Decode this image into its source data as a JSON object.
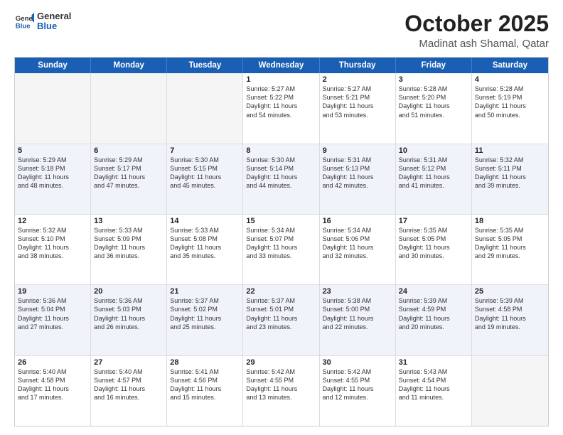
{
  "header": {
    "logo_general": "General",
    "logo_blue": "Blue",
    "month_title": "October 2025",
    "location": "Madinat ash Shamal, Qatar"
  },
  "days_of_week": [
    "Sunday",
    "Monday",
    "Tuesday",
    "Wednesday",
    "Thursday",
    "Friday",
    "Saturday"
  ],
  "weeks": [
    {
      "alt": false,
      "cells": [
        {
          "day": "",
          "empty": true,
          "lines": []
        },
        {
          "day": "",
          "empty": true,
          "lines": []
        },
        {
          "day": "",
          "empty": true,
          "lines": []
        },
        {
          "day": "1",
          "empty": false,
          "lines": [
            "Sunrise: 5:27 AM",
            "Sunset: 5:22 PM",
            "Daylight: 11 hours",
            "and 54 minutes."
          ]
        },
        {
          "day": "2",
          "empty": false,
          "lines": [
            "Sunrise: 5:27 AM",
            "Sunset: 5:21 PM",
            "Daylight: 11 hours",
            "and 53 minutes."
          ]
        },
        {
          "day": "3",
          "empty": false,
          "lines": [
            "Sunrise: 5:28 AM",
            "Sunset: 5:20 PM",
            "Daylight: 11 hours",
            "and 51 minutes."
          ]
        },
        {
          "day": "4",
          "empty": false,
          "lines": [
            "Sunrise: 5:28 AM",
            "Sunset: 5:19 PM",
            "Daylight: 11 hours",
            "and 50 minutes."
          ]
        }
      ]
    },
    {
      "alt": true,
      "cells": [
        {
          "day": "5",
          "empty": false,
          "lines": [
            "Sunrise: 5:29 AM",
            "Sunset: 5:18 PM",
            "Daylight: 11 hours",
            "and 48 minutes."
          ]
        },
        {
          "day": "6",
          "empty": false,
          "lines": [
            "Sunrise: 5:29 AM",
            "Sunset: 5:17 PM",
            "Daylight: 11 hours",
            "and 47 minutes."
          ]
        },
        {
          "day": "7",
          "empty": false,
          "lines": [
            "Sunrise: 5:30 AM",
            "Sunset: 5:15 PM",
            "Daylight: 11 hours",
            "and 45 minutes."
          ]
        },
        {
          "day": "8",
          "empty": false,
          "lines": [
            "Sunrise: 5:30 AM",
            "Sunset: 5:14 PM",
            "Daylight: 11 hours",
            "and 44 minutes."
          ]
        },
        {
          "day": "9",
          "empty": false,
          "lines": [
            "Sunrise: 5:31 AM",
            "Sunset: 5:13 PM",
            "Daylight: 11 hours",
            "and 42 minutes."
          ]
        },
        {
          "day": "10",
          "empty": false,
          "lines": [
            "Sunrise: 5:31 AM",
            "Sunset: 5:12 PM",
            "Daylight: 11 hours",
            "and 41 minutes."
          ]
        },
        {
          "day": "11",
          "empty": false,
          "lines": [
            "Sunrise: 5:32 AM",
            "Sunset: 5:11 PM",
            "Daylight: 11 hours",
            "and 39 minutes."
          ]
        }
      ]
    },
    {
      "alt": false,
      "cells": [
        {
          "day": "12",
          "empty": false,
          "lines": [
            "Sunrise: 5:32 AM",
            "Sunset: 5:10 PM",
            "Daylight: 11 hours",
            "and 38 minutes."
          ]
        },
        {
          "day": "13",
          "empty": false,
          "lines": [
            "Sunrise: 5:33 AM",
            "Sunset: 5:09 PM",
            "Daylight: 11 hours",
            "and 36 minutes."
          ]
        },
        {
          "day": "14",
          "empty": false,
          "lines": [
            "Sunrise: 5:33 AM",
            "Sunset: 5:08 PM",
            "Daylight: 11 hours",
            "and 35 minutes."
          ]
        },
        {
          "day": "15",
          "empty": false,
          "lines": [
            "Sunrise: 5:34 AM",
            "Sunset: 5:07 PM",
            "Daylight: 11 hours",
            "and 33 minutes."
          ]
        },
        {
          "day": "16",
          "empty": false,
          "lines": [
            "Sunrise: 5:34 AM",
            "Sunset: 5:06 PM",
            "Daylight: 11 hours",
            "and 32 minutes."
          ]
        },
        {
          "day": "17",
          "empty": false,
          "lines": [
            "Sunrise: 5:35 AM",
            "Sunset: 5:05 PM",
            "Daylight: 11 hours",
            "and 30 minutes."
          ]
        },
        {
          "day": "18",
          "empty": false,
          "lines": [
            "Sunrise: 5:35 AM",
            "Sunset: 5:05 PM",
            "Daylight: 11 hours",
            "and 29 minutes."
          ]
        }
      ]
    },
    {
      "alt": true,
      "cells": [
        {
          "day": "19",
          "empty": false,
          "lines": [
            "Sunrise: 5:36 AM",
            "Sunset: 5:04 PM",
            "Daylight: 11 hours",
            "and 27 minutes."
          ]
        },
        {
          "day": "20",
          "empty": false,
          "lines": [
            "Sunrise: 5:36 AM",
            "Sunset: 5:03 PM",
            "Daylight: 11 hours",
            "and 26 minutes."
          ]
        },
        {
          "day": "21",
          "empty": false,
          "lines": [
            "Sunrise: 5:37 AM",
            "Sunset: 5:02 PM",
            "Daylight: 11 hours",
            "and 25 minutes."
          ]
        },
        {
          "day": "22",
          "empty": false,
          "lines": [
            "Sunrise: 5:37 AM",
            "Sunset: 5:01 PM",
            "Daylight: 11 hours",
            "and 23 minutes."
          ]
        },
        {
          "day": "23",
          "empty": false,
          "lines": [
            "Sunrise: 5:38 AM",
            "Sunset: 5:00 PM",
            "Daylight: 11 hours",
            "and 22 minutes."
          ]
        },
        {
          "day": "24",
          "empty": false,
          "lines": [
            "Sunrise: 5:39 AM",
            "Sunset: 4:59 PM",
            "Daylight: 11 hours",
            "and 20 minutes."
          ]
        },
        {
          "day": "25",
          "empty": false,
          "lines": [
            "Sunrise: 5:39 AM",
            "Sunset: 4:58 PM",
            "Daylight: 11 hours",
            "and 19 minutes."
          ]
        }
      ]
    },
    {
      "alt": false,
      "cells": [
        {
          "day": "26",
          "empty": false,
          "lines": [
            "Sunrise: 5:40 AM",
            "Sunset: 4:58 PM",
            "Daylight: 11 hours",
            "and 17 minutes."
          ]
        },
        {
          "day": "27",
          "empty": false,
          "lines": [
            "Sunrise: 5:40 AM",
            "Sunset: 4:57 PM",
            "Daylight: 11 hours",
            "and 16 minutes."
          ]
        },
        {
          "day": "28",
          "empty": false,
          "lines": [
            "Sunrise: 5:41 AM",
            "Sunset: 4:56 PM",
            "Daylight: 11 hours",
            "and 15 minutes."
          ]
        },
        {
          "day": "29",
          "empty": false,
          "lines": [
            "Sunrise: 5:42 AM",
            "Sunset: 4:55 PM",
            "Daylight: 11 hours",
            "and 13 minutes."
          ]
        },
        {
          "day": "30",
          "empty": false,
          "lines": [
            "Sunrise: 5:42 AM",
            "Sunset: 4:55 PM",
            "Daylight: 11 hours",
            "and 12 minutes."
          ]
        },
        {
          "day": "31",
          "empty": false,
          "lines": [
            "Sunrise: 5:43 AM",
            "Sunset: 4:54 PM",
            "Daylight: 11 hours",
            "and 11 minutes."
          ]
        },
        {
          "day": "",
          "empty": true,
          "lines": []
        }
      ]
    }
  ]
}
